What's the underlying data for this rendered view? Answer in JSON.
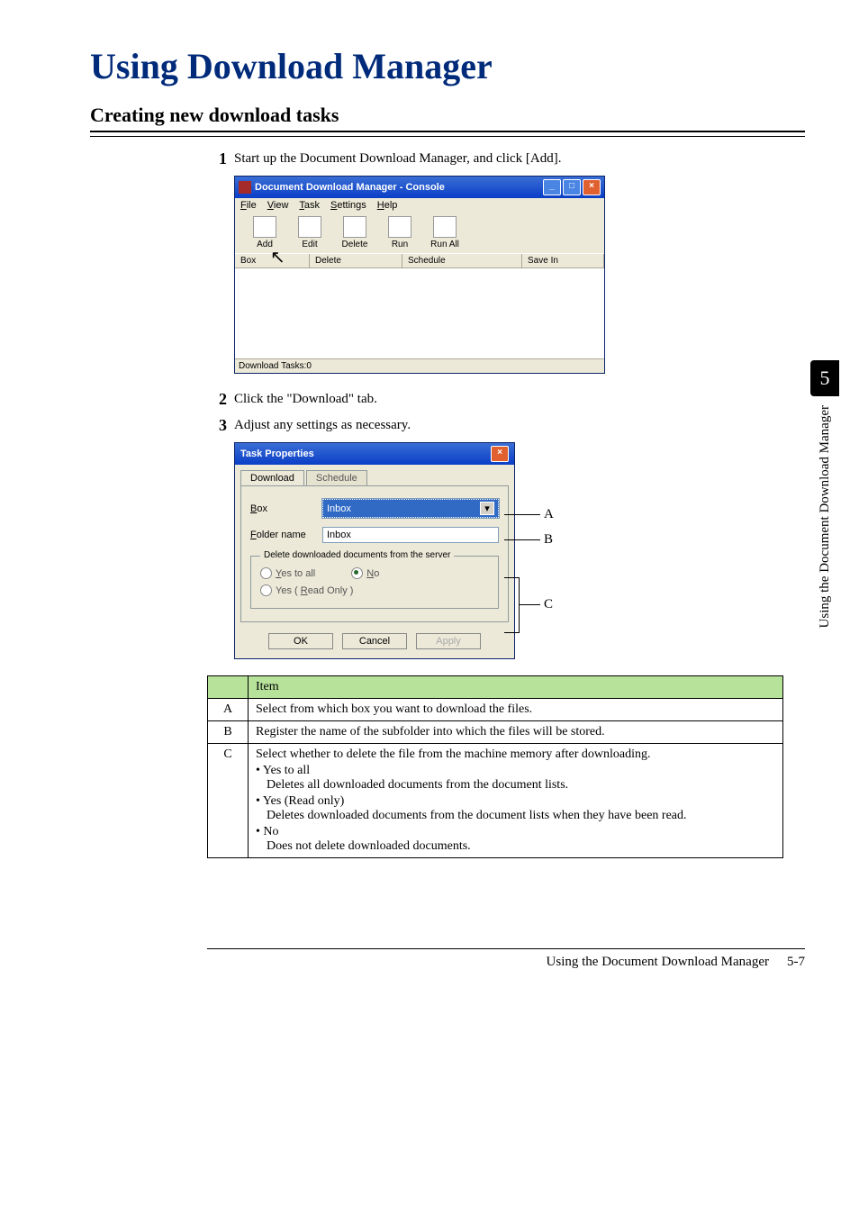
{
  "main_title": "Using Download Manager",
  "section_title": "Creating new download tasks",
  "steps": [
    "Start up the Document Download Manager, and click [Add].",
    "Click the \"Download\" tab.",
    "Adjust any settings as necessary."
  ],
  "console": {
    "title": "Document Download Manager - Console",
    "menus": [
      "File",
      "View",
      "Task",
      "Settings",
      "Help"
    ],
    "tools": [
      "Add",
      "Edit",
      "Delete",
      "Run",
      "Run All"
    ],
    "columns": [
      "Box",
      "Delete",
      "Schedule",
      "Save In"
    ],
    "status": "Download Tasks:0"
  },
  "dialog": {
    "title": "Task Properties",
    "tabs": [
      "Download",
      "Schedule"
    ],
    "box_label": "Box",
    "box_value": "Inbox",
    "folder_label": "Folder name",
    "folder_value": "Inbox",
    "group_title": "Delete downloaded documents from the server",
    "opt_yes_all": "Yes to all",
    "opt_no": "No",
    "opt_yes_ro": "Yes ( Read Only )",
    "btn_ok": "OK",
    "btn_cancel": "Cancel",
    "btn_apply": "Apply"
  },
  "callouts": {
    "a": "A",
    "b": "B",
    "c": "C"
  },
  "table": {
    "header": "Item",
    "rows": [
      {
        "key": "A",
        "desc_plain": "Select from which box you want to download the files."
      },
      {
        "key": "B",
        "desc_plain": "Register the name of the subfolder into which the files will be stored."
      },
      {
        "key": "C",
        "desc_lead": "Select whether to delete the file from the machine memory after downloading.",
        "bullets": [
          {
            "head": "Yes to all",
            "body": "Deletes all downloaded documents from the document lists."
          },
          {
            "head": "Yes (Read only)",
            "body": "Deletes downloaded documents from the document lists when they have been read."
          },
          {
            "head": "No",
            "body": "Does not delete downloaded documents."
          }
        ]
      }
    ]
  },
  "sidebar": {
    "chapter": "5",
    "text": "Using the Document Download Manager"
  },
  "footer": {
    "text": "Using the Document Download Manager",
    "page": "5-7"
  }
}
